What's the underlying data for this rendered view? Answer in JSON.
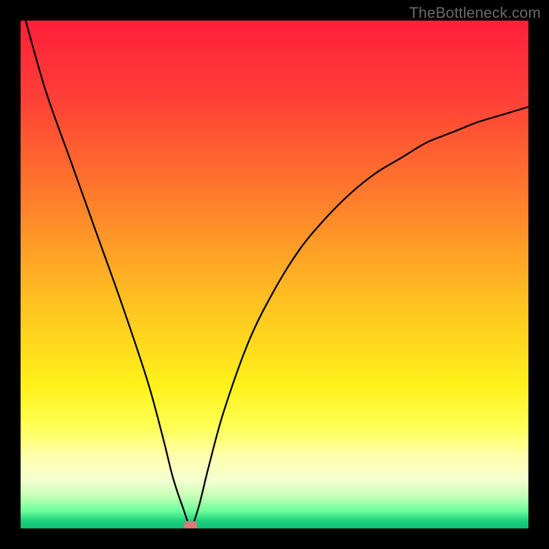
{
  "watermark": {
    "text": "TheBottleneck.com"
  },
  "colors": {
    "black": "#000000",
    "marker": "#d77a7a",
    "curve": "#000000",
    "watermark_text": "#6a6a6a"
  },
  "chart_data": {
    "type": "line",
    "title": "",
    "xlabel": "",
    "ylabel": "",
    "xlim": [
      0,
      100
    ],
    "ylim": [
      0,
      100
    ],
    "grid": false,
    "legend_position": "none",
    "background_gradient_stops": [
      {
        "offset": 0.0,
        "color": "#ff1f3a"
      },
      {
        "offset": 0.15,
        "color": "#ff3e37"
      },
      {
        "offset": 0.35,
        "color": "#ff7d2c"
      },
      {
        "offset": 0.55,
        "color": "#ffc021"
      },
      {
        "offset": 0.72,
        "color": "#fff21a"
      },
      {
        "offset": 0.8,
        "color": "#ffff55"
      },
      {
        "offset": 0.86,
        "color": "#ffffb0"
      },
      {
        "offset": 0.905,
        "color": "#f3ffcf"
      },
      {
        "offset": 0.935,
        "color": "#c8ffb8"
      },
      {
        "offset": 0.965,
        "color": "#6fff9c"
      },
      {
        "offset": 0.985,
        "color": "#1cd07e"
      },
      {
        "offset": 1.0,
        "color": "#0fbf73"
      }
    ],
    "series": [
      {
        "name": "bottleneck-curve",
        "x": [
          1,
          5,
          10,
          15,
          20,
          25,
          28,
          30,
          32,
          33.5,
          35,
          37,
          40,
          45,
          50,
          55,
          60,
          65,
          70,
          75,
          80,
          85,
          90,
          95,
          100
        ],
        "y": [
          100,
          86,
          72,
          58,
          44,
          29,
          18,
          10,
          4,
          0.5,
          4,
          12,
          23,
          37,
          47,
          55,
          61,
          66,
          70,
          73,
          76,
          78,
          80,
          81.5,
          83
        ]
      }
    ],
    "marker": {
      "x": 33.5,
      "y": 0.5
    },
    "curve_min_x_fraction": 0.335
  }
}
